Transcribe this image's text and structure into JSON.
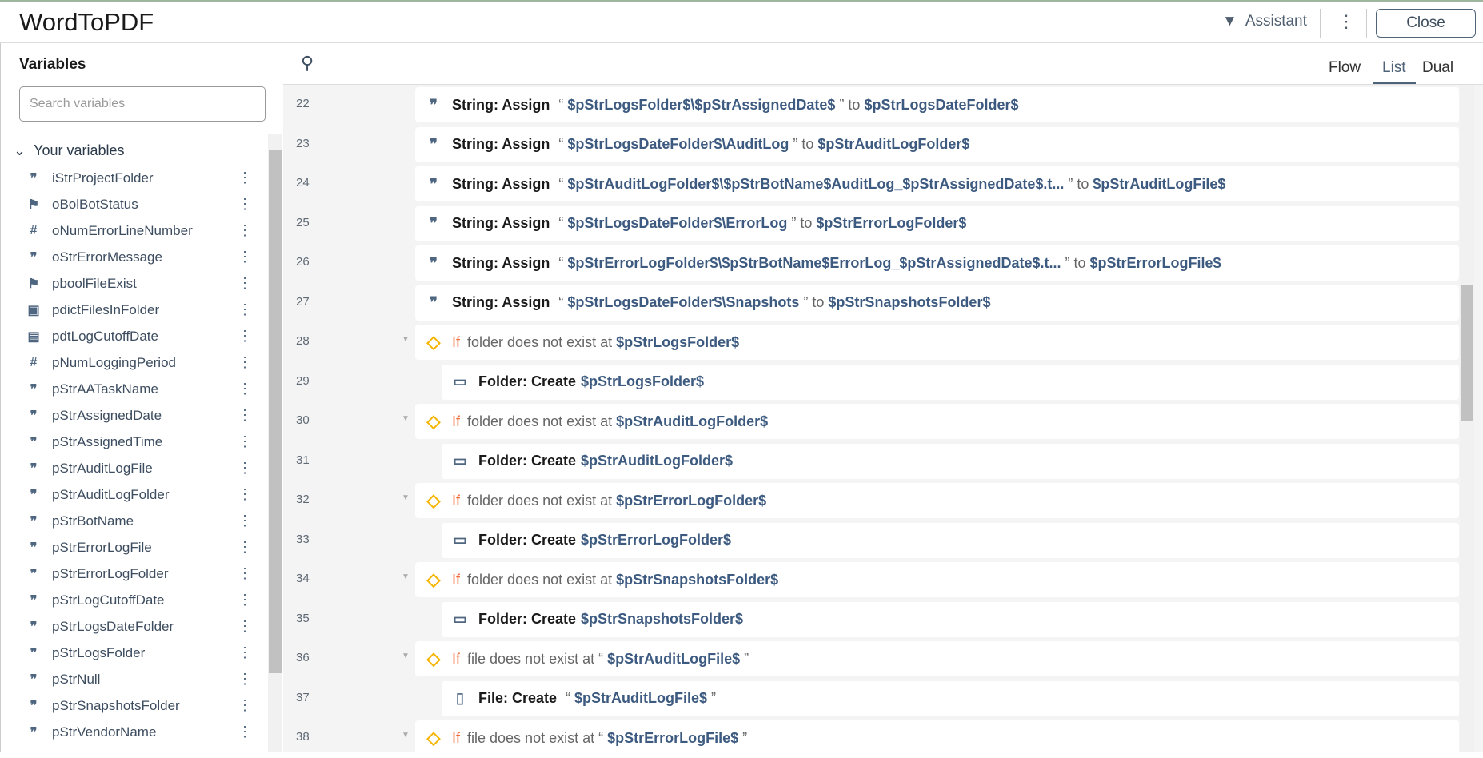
{
  "header": {
    "title": "WordToPDF",
    "assistant": "Assistant",
    "close": "Close"
  },
  "sidebar": {
    "heading": "Variables",
    "search_placeholder": "Search variables",
    "group": "Your variables",
    "items": [
      {
        "name": "iStrProjectFolder",
        "icon": "string"
      },
      {
        "name": "oBolBotStatus",
        "icon": "boolean"
      },
      {
        "name": "oNumErrorLineNumber",
        "icon": "number"
      },
      {
        "name": "oStrErrorMessage",
        "icon": "string"
      },
      {
        "name": "pboolFileExist",
        "icon": "boolean"
      },
      {
        "name": "pdictFilesInFolder",
        "icon": "dictionary"
      },
      {
        "name": "pdtLogCutoffDate",
        "icon": "datetime"
      },
      {
        "name": "pNumLoggingPeriod",
        "icon": "number"
      },
      {
        "name": "pStrAATaskName",
        "icon": "string"
      },
      {
        "name": "pStrAssignedDate",
        "icon": "string"
      },
      {
        "name": "pStrAssignedTime",
        "icon": "string"
      },
      {
        "name": "pStrAuditLogFile",
        "icon": "string"
      },
      {
        "name": "pStrAuditLogFolder",
        "icon": "string"
      },
      {
        "name": "pStrBotName",
        "icon": "string"
      },
      {
        "name": "pStrErrorLogFile",
        "icon": "string"
      },
      {
        "name": "pStrErrorLogFolder",
        "icon": "string"
      },
      {
        "name": "pStrLogCutoffDate",
        "icon": "string"
      },
      {
        "name": "pStrLogsDateFolder",
        "icon": "string"
      },
      {
        "name": "pStrLogsFolder",
        "icon": "string"
      },
      {
        "name": "pStrNull",
        "icon": "string"
      },
      {
        "name": "pStrSnapshotsFolder",
        "icon": "string"
      },
      {
        "name": "pStrVendorName",
        "icon": "string"
      }
    ]
  },
  "views": [
    "Flow",
    "List",
    "Dual"
  ],
  "active_view": "List",
  "rows": [
    {
      "n": "22",
      "icon": "string",
      "indent": 0,
      "parts": [
        [
          "lab",
          "String: Assign"
        ],
        [
          "pl",
          "“"
        ],
        [
          "vr",
          "$pStrLogsFolder$\\$pStrAssignedDate$"
        ],
        [
          "pl",
          "” to"
        ],
        [
          "vr",
          "$pStrLogsDateFolder$"
        ]
      ]
    },
    {
      "n": "23",
      "icon": "string",
      "indent": 0,
      "parts": [
        [
          "lab",
          "String: Assign"
        ],
        [
          "pl",
          "“"
        ],
        [
          "vr",
          "$pStrLogsDateFolder$\\AuditLog"
        ],
        [
          "pl",
          "” to"
        ],
        [
          "vr",
          "$pStrAuditLogFolder$"
        ]
      ]
    },
    {
      "n": "24",
      "icon": "string",
      "indent": 0,
      "parts": [
        [
          "lab",
          "String: Assign"
        ],
        [
          "pl",
          "“"
        ],
        [
          "vr",
          "$pStrAuditLogFolder$\\$pStrBotName$AuditLog_$pStrAssignedDate$.t..."
        ],
        [
          "pl",
          "” to"
        ],
        [
          "vr",
          "$pStrAuditLogFile$"
        ]
      ]
    },
    {
      "n": "25",
      "icon": "string",
      "indent": 0,
      "parts": [
        [
          "lab",
          "String: Assign"
        ],
        [
          "pl",
          "“"
        ],
        [
          "vr",
          "$pStrLogsDateFolder$\\ErrorLog"
        ],
        [
          "pl",
          "” to"
        ],
        [
          "vr",
          "$pStrErrorLogFolder$"
        ]
      ]
    },
    {
      "n": "26",
      "icon": "string",
      "indent": 0,
      "parts": [
        [
          "lab",
          "String: Assign"
        ],
        [
          "pl",
          "“"
        ],
        [
          "vr",
          "$pStrErrorLogFolder$\\$pStrBotName$ErrorLog_$pStrAssignedDate$.t..."
        ],
        [
          "pl",
          "” to"
        ],
        [
          "vr",
          "$pStrErrorLogFile$"
        ]
      ]
    },
    {
      "n": "27",
      "icon": "string",
      "indent": 0,
      "parts": [
        [
          "lab",
          "String: Assign"
        ],
        [
          "pl",
          "“"
        ],
        [
          "vr",
          "$pStrLogsDateFolder$\\Snapshots"
        ],
        [
          "pl",
          "” to"
        ],
        [
          "vr",
          "$pStrSnapshotsFolder$"
        ]
      ]
    },
    {
      "n": "28",
      "icon": "if",
      "indent": 0,
      "parts": [
        [
          "iff",
          "If"
        ],
        [
          "pl",
          "folder does not exist at"
        ],
        [
          "vr",
          "$pStrLogsFolder$"
        ]
      ]
    },
    {
      "n": "29",
      "icon": "folder",
      "indent": 1,
      "parts": [
        [
          "lab",
          "Folder: Create"
        ],
        [
          "vr",
          "$pStrLogsFolder$"
        ]
      ]
    },
    {
      "n": "30",
      "icon": "if",
      "indent": 0,
      "parts": [
        [
          "iff",
          "If"
        ],
        [
          "pl",
          "folder does not exist at"
        ],
        [
          "vr",
          "$pStrAuditLogFolder$"
        ]
      ]
    },
    {
      "n": "31",
      "icon": "folder",
      "indent": 1,
      "parts": [
        [
          "lab",
          "Folder: Create"
        ],
        [
          "vr",
          "$pStrAuditLogFolder$"
        ]
      ]
    },
    {
      "n": "32",
      "icon": "if",
      "indent": 0,
      "parts": [
        [
          "iff",
          "If"
        ],
        [
          "pl",
          "folder does not exist at"
        ],
        [
          "vr",
          "$pStrErrorLogFolder$"
        ]
      ]
    },
    {
      "n": "33",
      "icon": "folder",
      "indent": 1,
      "parts": [
        [
          "lab",
          "Folder: Create"
        ],
        [
          "vr",
          "$pStrErrorLogFolder$"
        ]
      ]
    },
    {
      "n": "34",
      "icon": "if",
      "indent": 0,
      "parts": [
        [
          "iff",
          "If"
        ],
        [
          "pl",
          "folder does not exist at"
        ],
        [
          "vr",
          "$pStrSnapshotsFolder$"
        ]
      ]
    },
    {
      "n": "35",
      "icon": "folder",
      "indent": 1,
      "parts": [
        [
          "lab",
          "Folder: Create"
        ],
        [
          "vr",
          "$pStrSnapshotsFolder$"
        ]
      ]
    },
    {
      "n": "36",
      "icon": "if",
      "indent": 0,
      "parts": [
        [
          "iff",
          "If"
        ],
        [
          "pl",
          "file does not exist at “"
        ],
        [
          "vr",
          "$pStrAuditLogFile$"
        ],
        [
          "pl",
          "”"
        ]
      ]
    },
    {
      "n": "37",
      "icon": "file",
      "indent": 1,
      "parts": [
        [
          "lab",
          "File: Create"
        ],
        [
          "pl",
          "“"
        ],
        [
          "vr",
          "$pStrAuditLogFile$"
        ],
        [
          "pl",
          "”"
        ]
      ]
    },
    {
      "n": "38",
      "icon": "if",
      "indent": 0,
      "parts": [
        [
          "iff",
          "If"
        ],
        [
          "pl",
          "file does not exist at “"
        ],
        [
          "vr",
          "$pStrErrorLogFile$"
        ],
        [
          "pl",
          "”"
        ]
      ]
    }
  ]
}
